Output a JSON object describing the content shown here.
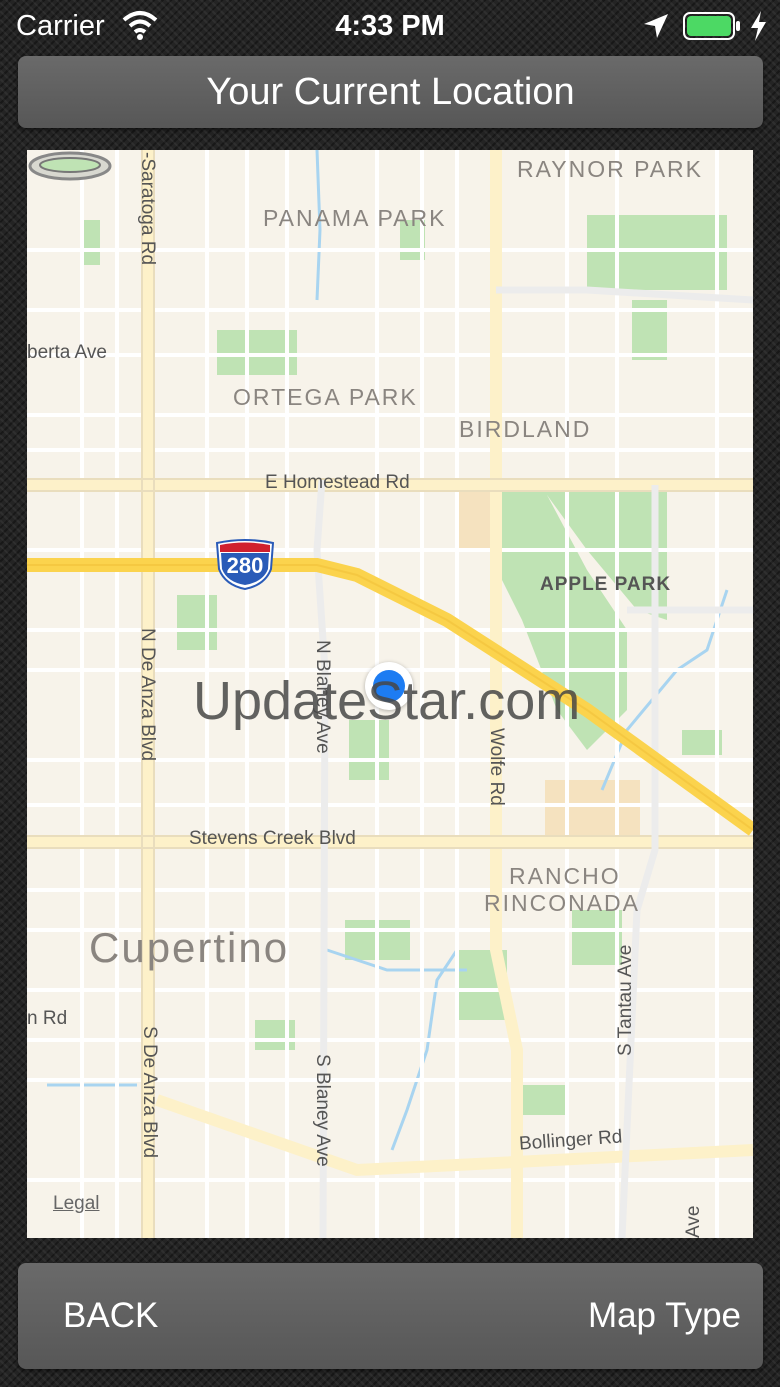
{
  "status_bar": {
    "carrier": "Carrier",
    "time": "4:33 PM",
    "battery_color": "#4cd964"
  },
  "header": {
    "title": "Your Current Location"
  },
  "map": {
    "areas": {
      "raynor_park": "RAYNOR PARK",
      "panama_park": "PANAMA PARK",
      "ortega_park": "ORTEGA PARK",
      "birdland": "BIRDLAND",
      "apple_park": "APPLE PARK",
      "rancho": "RANCHO",
      "rinconada": "RINCONADA",
      "city": "Cupertino"
    },
    "streets": {
      "saratoga": "-Saratoga Rd",
      "alberta": "berta Ave",
      "homestead": "E Homestead Rd",
      "n_de_anza": "N De Anza Blvd",
      "n_blaney": "N Blaney Ave",
      "wolfe": "Wolfe Rd",
      "stevens_creek": "Stevens Creek Blvd",
      "rd_left": "n Rd",
      "s_de_anza": "S De Anza Blvd",
      "s_blaney": "S Blaney Ave",
      "tantau": "S Tantau Ave",
      "bollinger": "Bollinger Rd",
      "ave_bottom": "Ave"
    },
    "highway_shield": "280",
    "watermark": "UpdateStar.com",
    "legal": "Legal",
    "colors": {
      "land": "#f7f3ea",
      "park": "#bfe3b4",
      "highway": "#fbd34d",
      "water": "#a8d4f0",
      "user_dot": "#1d7cf2"
    }
  },
  "footer": {
    "back_label": "BACK",
    "map_type_label": "Map Type"
  }
}
